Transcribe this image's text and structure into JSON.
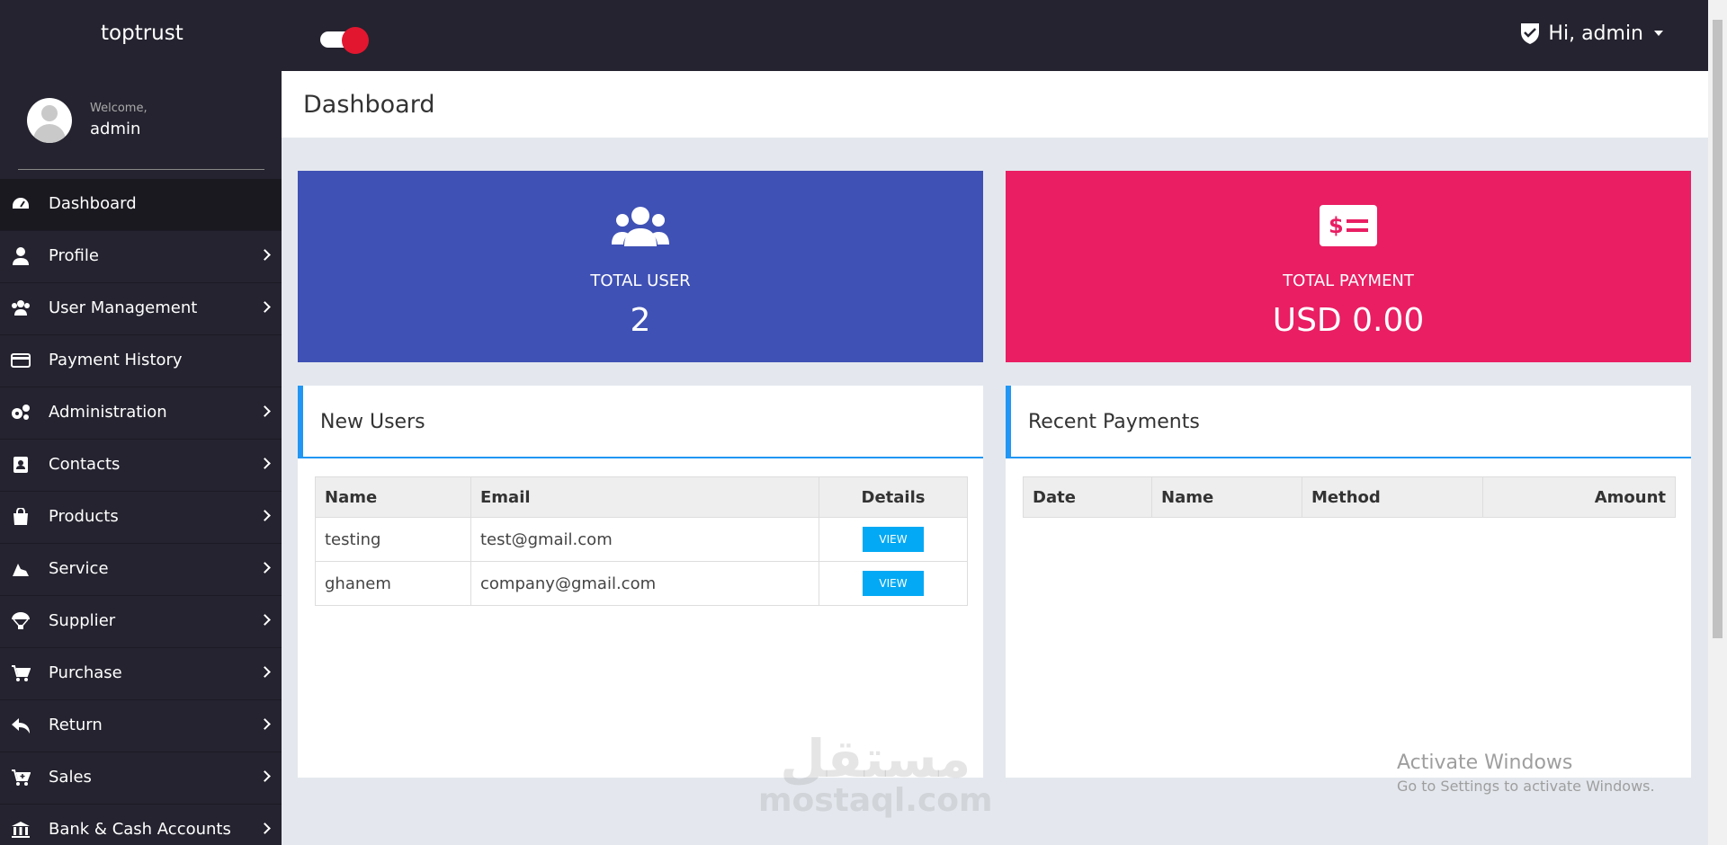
{
  "app": {
    "brand": "toptrust"
  },
  "header": {
    "user_greeting": "Hi, admin",
    "icon": "shield-check-icon"
  },
  "sidebar": {
    "welcome": "Welcome,",
    "username": "admin",
    "items": [
      {
        "label": "Dashboard",
        "icon": "dashboard-icon",
        "has_submenu": false,
        "active": true
      },
      {
        "label": "Profile",
        "icon": "user-icon",
        "has_submenu": true
      },
      {
        "label": "User Management",
        "icon": "users-icon",
        "has_submenu": true
      },
      {
        "label": "Payment History",
        "icon": "credit-card-icon",
        "has_submenu": false
      },
      {
        "label": "Administration",
        "icon": "gears-icon",
        "has_submenu": true
      },
      {
        "label": "Contacts",
        "icon": "address-book-icon",
        "has_submenu": true
      },
      {
        "label": "Products",
        "icon": "shopping-bag-icon",
        "has_submenu": true
      },
      {
        "label": "Service",
        "icon": "service-icon",
        "has_submenu": true
      },
      {
        "label": "Supplier",
        "icon": "parachute-box-icon",
        "has_submenu": true
      },
      {
        "label": "Purchase",
        "icon": "cart-icon",
        "has_submenu": true
      },
      {
        "label": "Return",
        "icon": "reply-icon",
        "has_submenu": true
      },
      {
        "label": "Sales",
        "icon": "cart-plus-icon",
        "has_submenu": true
      },
      {
        "label": "Bank & Cash Accounts",
        "icon": "bank-icon",
        "has_submenu": true
      }
    ]
  },
  "page": {
    "title": "Dashboard"
  },
  "stats": {
    "users": {
      "label": "TOTAL USER",
      "value": "2",
      "color": "#3f51b5",
      "icon": "users-icon"
    },
    "payment": {
      "label": "TOTAL PAYMENT",
      "value": "USD 0.00",
      "color": "#e91e63",
      "icon": "money-check-icon"
    }
  },
  "new_users": {
    "title": "New Users",
    "columns": [
      "Name",
      "Email",
      "Details"
    ],
    "rows": [
      {
        "name": "testing",
        "email": "test@gmail.com",
        "action": "VIEW"
      },
      {
        "name": "ghanem",
        "email": "company@gmail.com",
        "action": "VIEW"
      }
    ]
  },
  "recent_payments": {
    "title": "Recent Payments",
    "columns": [
      "Date",
      "Name",
      "Method",
      "Amount"
    ]
  },
  "overlay": {
    "activate_title": "Activate Windows",
    "activate_sub": "Go to Settings to activate Windows.",
    "watermark_ar": "مستقل",
    "watermark_en": "mostaql.com"
  }
}
